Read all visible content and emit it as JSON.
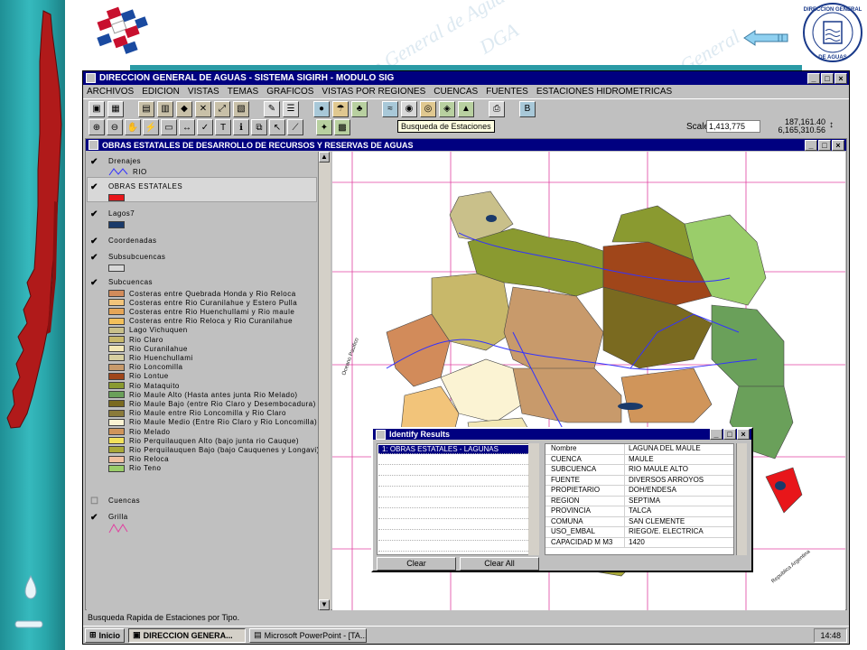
{
  "main_window": {
    "title": "DIRECCION GENERAL DE AGUAS - SISTEMA SIGIRH - MODULO SIG",
    "controls": {
      "minimize": "_",
      "maximize": "□",
      "close": "×"
    }
  },
  "menu": [
    "ARCHIVOS",
    "EDICION",
    "VISTAS",
    "TEMAS",
    "GRAFICOS",
    "VISTAS POR REGIONES",
    "CUENCAS",
    "FUENTES",
    "ESTACIONES HIDROMETRICAS"
  ],
  "toolbar2": {
    "tooltip": "Busqueda de Estaciones",
    "scale_label": "Scale 1:",
    "scale_value": "1,413,775",
    "coord_x": "187,161.40",
    "coord_y": "6,165,310.56",
    "coord_arrows": "↕"
  },
  "document_window": {
    "title": "OBRAS ESTATALES DE DESARROLLO DE RECURSOS Y RESERVAS DE AGUAS"
  },
  "legend": {
    "check_mark": "✔",
    "drenajes": {
      "title": "Drenajes",
      "item": "RIO"
    },
    "obras": {
      "title": "OBRAS ESTATALES"
    },
    "lagos": {
      "title": "Lagos7"
    },
    "coordenadas": {
      "title": "Coordenadas"
    },
    "subsubcuencas": {
      "title": "Subsubcuencas"
    },
    "subcuencas": {
      "title": "Subcuencas",
      "items": [
        {
          "label": "Costeras entre Quebrada Honda y Rio Reloca",
          "color": "#d28b5a"
        },
        {
          "label": "Costeras entre Rio Curanilahue y Estero Pulla",
          "color": "#f2c47a"
        },
        {
          "label": "Costeras entre Rio Huenchullami y Rio maule",
          "color": "#e6a657"
        },
        {
          "label": "Costeras entre Rio Reloca y Rio Curanilahue",
          "color": "#f3c05a"
        },
        {
          "label": "Lago Vichuquen",
          "color": "#c9c08a"
        },
        {
          "label": "Rio Claro",
          "color": "#c8b86a"
        },
        {
          "label": "Rio Curanilahue",
          "color": "#f3e8b5"
        },
        {
          "label": "Rio Huenchullami",
          "color": "#d8d0a0"
        },
        {
          "label": "Rio Loncomilla",
          "color": "#c89a6b"
        },
        {
          "label": "Rio Lontue",
          "color": "#a0461a"
        },
        {
          "label": "Rio Mataquito",
          "color": "#8a9a30"
        },
        {
          "label": "Rio Maule Alto (Hasta antes junta Rio Melado)",
          "color": "#6aa05a"
        },
        {
          "label": "Rio Maule Bajo (entre Rio Claro y Desembocadura)",
          "color": "#7a6a20"
        },
        {
          "label": "Rio Maule entre Rio Loncomilla y Rio Claro",
          "color": "#8a7a3a"
        },
        {
          "label": "Rio Maule Medio (Entre Rio Claro y Rio Loncomilla)",
          "color": "#fbf3d3"
        },
        {
          "label": "Rio Melado",
          "color": "#d0955a"
        },
        {
          "label": "Rio Perquilauquen Alto (bajo junta rio Cauque)",
          "color": "#f2e25a"
        },
        {
          "label": "Rio Perquilauquen Bajo (bajo Cauquenes y Longavi)",
          "color": "#a8a838"
        },
        {
          "label": "Rio Reloca",
          "color": "#f0c0a0"
        },
        {
          "label": "Rio Teno",
          "color": "#9acd6a"
        }
      ]
    },
    "cuencas": {
      "title": "Cuencas"
    },
    "grilla": {
      "title": "Grilla"
    }
  },
  "map": {
    "labels": {
      "ocean": "Oceano Pacifico",
      "argentina": "Republica Argentina"
    }
  },
  "status_text": "Busqueda Rapida de Estaciones por Tipo.",
  "taskbar": {
    "start": "Inicio",
    "app1": "DIRECCION GENERA...",
    "app2": "Microsoft PowerPoint - [TA...",
    "clock": "14:48"
  },
  "identify": {
    "title": "Identify Results",
    "list_selected": "1:  OBRAS ESTATALES - LAGUNAS",
    "rows": [
      {
        "key": "Nombre",
        "value": "LAGUNA DEL MAULE"
      },
      {
        "key": "CUENCA",
        "value": "MAULE"
      },
      {
        "key": "SUBCUENCA",
        "value": "RIO MAULE ALTO"
      },
      {
        "key": "FUENTE",
        "value": "DIVERSOS ARROYOS"
      },
      {
        "key": "PROPIETARIO",
        "value": "DOH/ENDESA"
      },
      {
        "key": "REGION",
        "value": "SEPTIMA"
      },
      {
        "key": "PROVINCIA",
        "value": "TALCA"
      },
      {
        "key": "COMUNA",
        "value": "SAN CLEMENTE"
      },
      {
        "key": "USO_EMBAL",
        "value": "RIEGO/E. ELECTRICA"
      },
      {
        "key": "CAPACIDAD M M3",
        "value": "1420"
      }
    ],
    "clear_label": "Clear",
    "clear_all_label": "Clear All"
  },
  "seal": {
    "line1": "DIRECCION GENERAL",
    "line2": "DE AGUAS"
  },
  "watermark": [
    "Direccion General de Aguas",
    "General",
    "DGA"
  ],
  "colors": {
    "accent": "#2a9aa5",
    "titlebar": "#000080",
    "obras_red": "#e8161a",
    "lagos_blue": "#1a3a6a",
    "river": "#3232ff",
    "grid": "#e040a0"
  }
}
